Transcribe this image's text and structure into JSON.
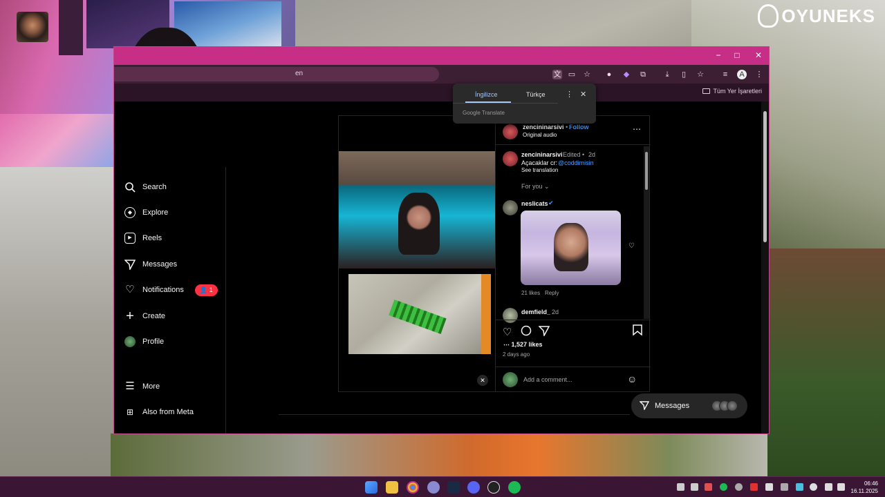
{
  "overlay": {
    "logo_text": "OYUNEKS"
  },
  "browser": {
    "address_text": "en",
    "bookmarks_label": "Tüm Yer İşaretleri",
    "window_controls": {
      "minimize": "−",
      "maximize": "□",
      "close": "✕"
    }
  },
  "translate_popup": {
    "tab_source": "İngilizce",
    "tab_target": "Türkçe",
    "footer": "Google Translate"
  },
  "sidebar": {
    "items": [
      {
        "label": "Search",
        "icon": "search-icon"
      },
      {
        "label": "Explore",
        "icon": "compass-icon"
      },
      {
        "label": "Reels",
        "icon": "reels-icon"
      },
      {
        "label": "Messages",
        "icon": "paper-plane-icon"
      },
      {
        "label": "Notifications",
        "icon": "heart-icon",
        "badge": "1"
      },
      {
        "label": "Create",
        "icon": "plus-icon"
      },
      {
        "label": "Profile",
        "icon": "avatar-icon"
      },
      {
        "label": "More",
        "icon": "hamburger-icon"
      },
      {
        "label": "Also from Meta",
        "icon": "meta-grid-icon"
      }
    ]
  },
  "post": {
    "author": "zencininarsivi",
    "follow": "Follow",
    "audio": "Original audio",
    "caption_author": "zencininarsivi",
    "edited": "Edited •",
    "caption_age": "2d",
    "caption_text": "Açacaklar cr:",
    "caption_mention": "@coddimisin",
    "see_translation": "See translation",
    "for_you": "For you",
    "comment1_author": "neslicats",
    "comment1_likes": "21 likes",
    "comment1_reply": "Reply",
    "comment2_author": "demfield_",
    "comment2_age": "2d",
    "likes": "1,527 likes",
    "age": "2 days ago",
    "add_comment_placeholder": "Add a comment..."
  },
  "messages_pill": {
    "label": "Messages"
  },
  "taskbar": {
    "time": "06:46",
    "date": "16.11.2025"
  },
  "colors": {
    "window_frame": "#c72f86",
    "badge": "#ff3040",
    "link": "#4a9eff",
    "taskbar": "#3a1534"
  }
}
